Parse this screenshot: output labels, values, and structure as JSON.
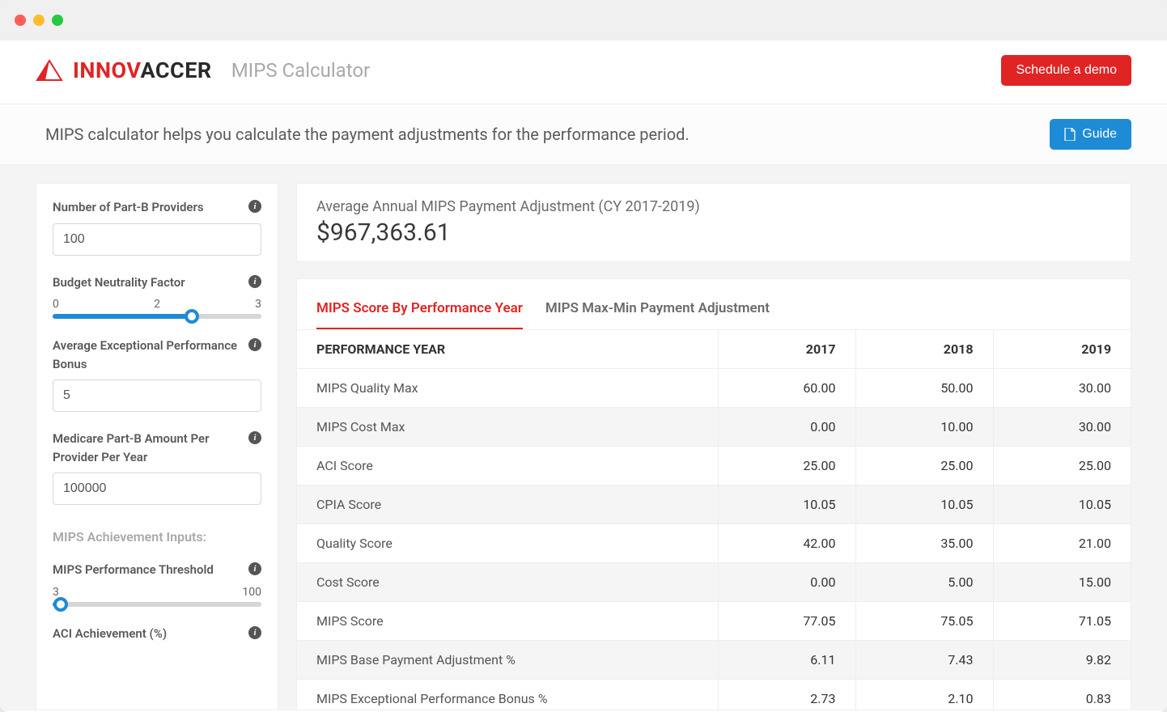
{
  "brand": {
    "part1": "INNOV",
    "part2": "ACCER"
  },
  "app_subtitle": "MIPS Calculator",
  "header": {
    "cta": "Schedule a demo"
  },
  "subheader": {
    "text": "MIPS calculator helps you calculate the payment adjustments for the performance period.",
    "guide_btn": "Guide"
  },
  "sidebar": {
    "fields": {
      "providers": {
        "label": "Number of Part-B Providers",
        "value": "100"
      },
      "bnf": {
        "label": "Budget Neutrality Factor",
        "min": "0",
        "mid": "2",
        "max": "3",
        "value_pct": 66.6
      },
      "bonus": {
        "label": "Average Exceptional Performance Bonus",
        "value": "5"
      },
      "medicare": {
        "label": "Medicare Part-B Amount Per Provider Per Year",
        "value": "100000"
      },
      "threshold": {
        "label": "MIPS Performance Threshold",
        "min": "3",
        "max": "100",
        "value_pct": 4
      },
      "aci": {
        "label": "ACI Achievement (%)"
      }
    },
    "section_title": "MIPS Achievement Inputs:"
  },
  "summary": {
    "label": "Average Annual MIPS Payment Adjustment (CY 2017-2019)",
    "value": "$967,363.61"
  },
  "tabs": [
    {
      "label": "MIPS Score By Performance Year",
      "active": true
    },
    {
      "label": "MIPS Max-Min Payment Adjustment",
      "active": false
    }
  ],
  "table": {
    "header": [
      "PERFORMANCE YEAR",
      "2017",
      "2018",
      "2019"
    ],
    "rows": [
      {
        "label": "MIPS Quality Max",
        "v": [
          "60.00",
          "50.00",
          "30.00"
        ]
      },
      {
        "label": "MIPS Cost Max",
        "v": [
          "0.00",
          "10.00",
          "30.00"
        ]
      },
      {
        "label": "ACI Score",
        "v": [
          "25.00",
          "25.00",
          "25.00"
        ]
      },
      {
        "label": "CPIA Score",
        "v": [
          "10.05",
          "10.05",
          "10.05"
        ]
      },
      {
        "label": "Quality Score",
        "v": [
          "42.00",
          "35.00",
          "21.00"
        ]
      },
      {
        "label": "Cost Score",
        "v": [
          "0.00",
          "5.00",
          "15.00"
        ]
      },
      {
        "label": "MIPS Score",
        "v": [
          "77.05",
          "75.05",
          "71.05"
        ]
      },
      {
        "label": "MIPS Base Payment Adjustment %",
        "v": [
          "6.11",
          "7.43",
          "9.82"
        ]
      },
      {
        "label": "MIPS Exceptional Performance Bonus %",
        "v": [
          "2.73",
          "2.10",
          "0.83"
        ]
      }
    ]
  }
}
